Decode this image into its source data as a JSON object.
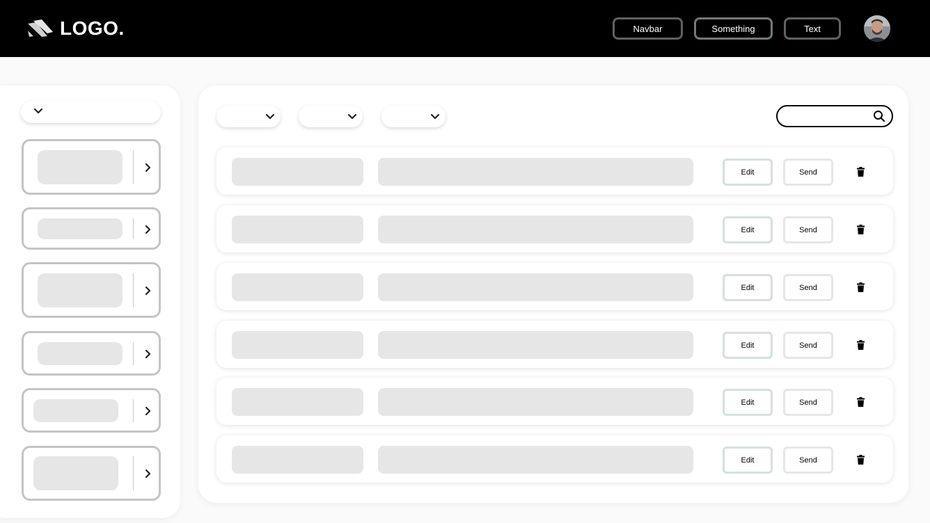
{
  "header": {
    "logo_text": "LOGO.",
    "nav": [
      "Navbar",
      "Something",
      "Text"
    ]
  },
  "sidebar": {
    "select_value": "",
    "cards": [
      {
        "label": ""
      },
      {
        "label": ""
      },
      {
        "label": ""
      },
      {
        "label": ""
      },
      {
        "label": ""
      },
      {
        "label": ""
      }
    ]
  },
  "toolbar": {
    "filters": [
      "",
      "",
      ""
    ],
    "search_value": ""
  },
  "rows": [
    {
      "edit_label": "Edit",
      "send_label": "Send"
    },
    {
      "edit_label": "Edit",
      "send_label": "Send"
    },
    {
      "edit_label": "Edit",
      "send_label": "Send"
    },
    {
      "edit_label": "Edit",
      "send_label": "Send"
    },
    {
      "edit_label": "Edit",
      "send_label": "Send"
    },
    {
      "edit_label": "Edit",
      "send_label": "Send"
    }
  ],
  "colors": {
    "header_bg": "#000000",
    "edit_border": "#d2e2dc",
    "placeholder": "#e6e6e6"
  },
  "icons": [
    "logo-icon",
    "chevron-down-icon",
    "chevron-right-icon",
    "search-icon",
    "trash-icon",
    "avatar"
  ]
}
